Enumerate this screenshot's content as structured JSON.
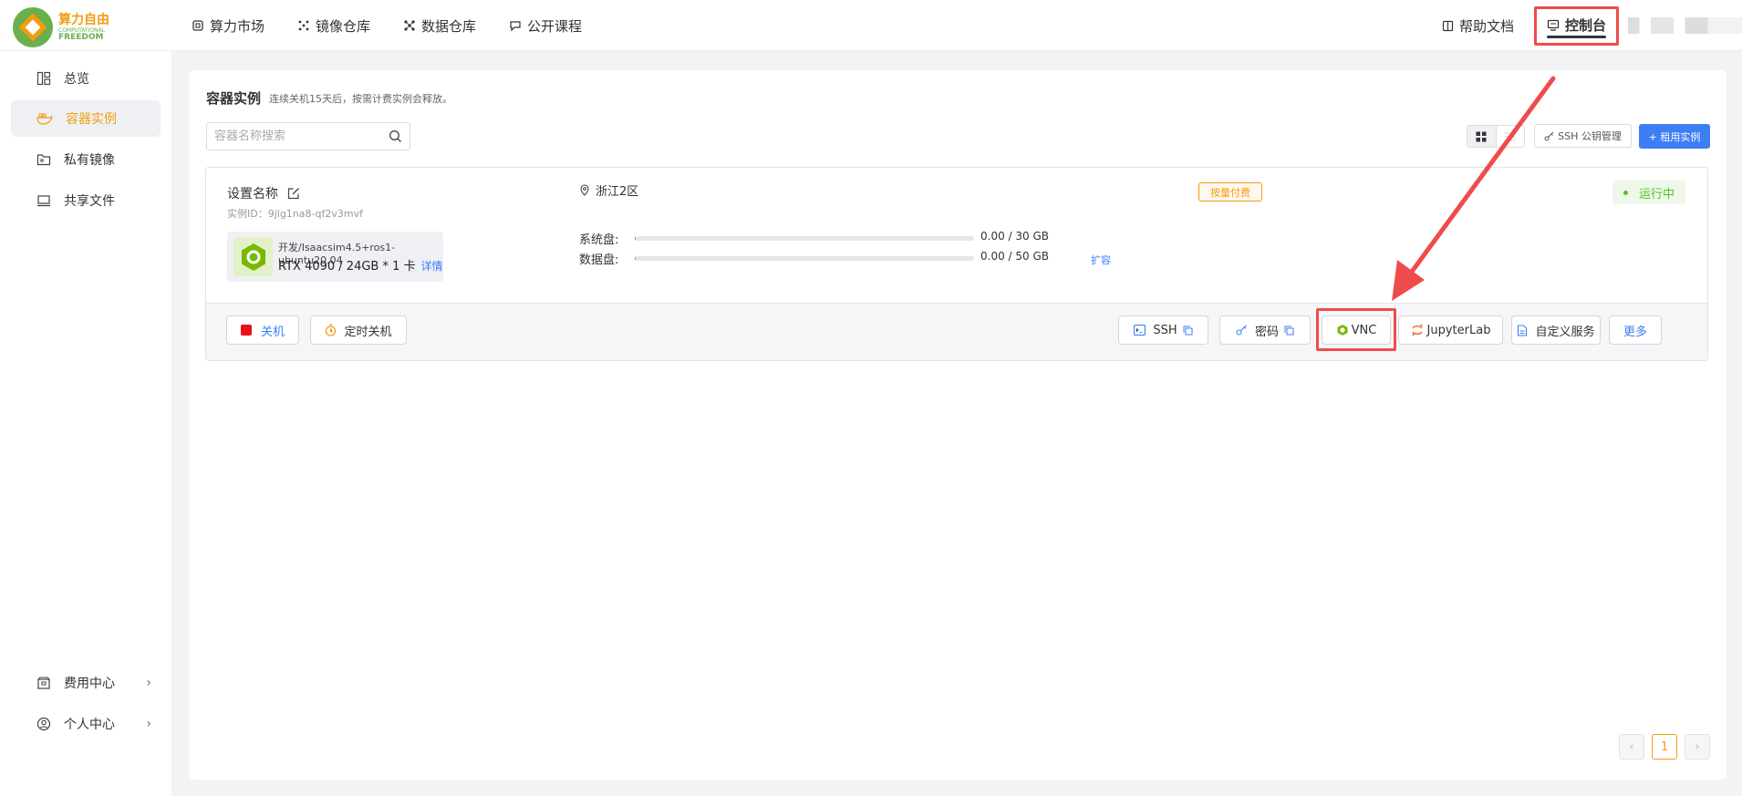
{
  "brand": {
    "name_cn": "算力自由",
    "name_en1": "COMPUTATIONAL",
    "name_en2": "FREEDOM"
  },
  "nav": {
    "items": [
      "算力市场",
      "镜像仓库",
      "数据仓库",
      "公开课程"
    ]
  },
  "top_right": {
    "help": "帮助文档",
    "console": "控制台"
  },
  "sidebar": {
    "items": [
      "总览",
      "容器实例",
      "私有镜像",
      "共享文件"
    ],
    "bottom_items": [
      "费用中心",
      "个人中心"
    ],
    "chevron": "›"
  },
  "main": {
    "title": "容器实例",
    "subtitle": "连续关机15天后，按需计费实例会释放。",
    "search_placeholder": "容器名称搜索",
    "ssh_key_label": "SSH 公钥管理",
    "rent_label": "+ 租用实例"
  },
  "instance": {
    "name": "设置名称",
    "id": "实例ID：9jlg1na8-qf2v3mvf",
    "image": "开发/Isaacsim4.5+ros1-ubuntu20.04",
    "spec": "RTX 4090 / 24GB  *  1 卡",
    "detail": "详情",
    "region": "浙江2区",
    "billing": "按量付费",
    "status": "运行中",
    "status_color": "#52c41a",
    "system_disk_label": "系统盘:",
    "system_disk_value": "0.00 / 30 GB",
    "system_disk_used": 0.0,
    "data_disk_label": "数据盘:",
    "data_disk_value": "0.00 / 50 GB",
    "data_disk_used": 0.0,
    "expand": "扩容"
  },
  "actions": {
    "shutdown": "关机",
    "timer": "定时关机",
    "ssh": "SSH",
    "password": "密码",
    "vnc": "VNC",
    "jupyter": "JupyterLab",
    "custom": "自定义服务",
    "more": "更多"
  },
  "pagination": {
    "prev": "‹",
    "current": "1",
    "next": "›"
  },
  "colors": {
    "accent": "#f39c12",
    "primary": "#3d7ef5",
    "highlight": "#ee4c4c"
  }
}
